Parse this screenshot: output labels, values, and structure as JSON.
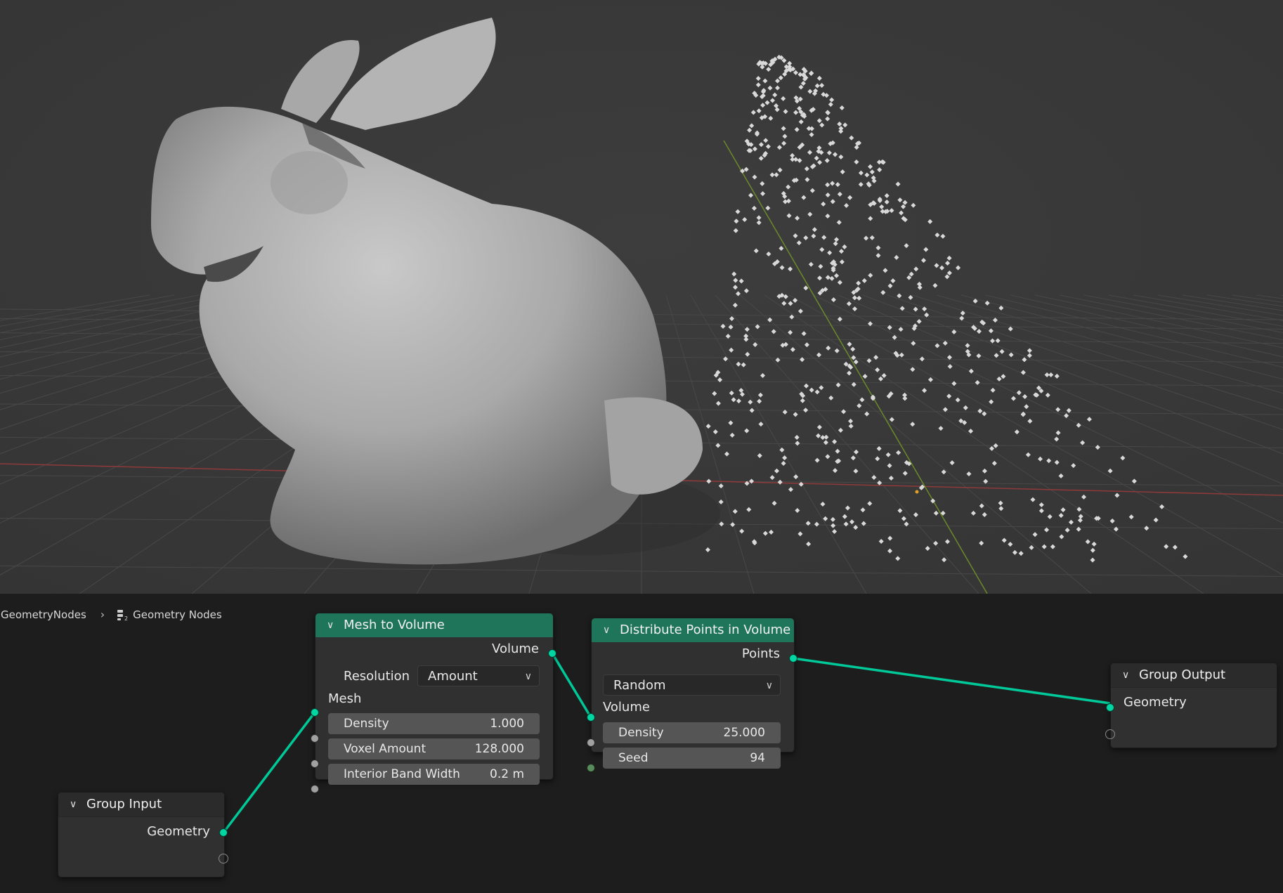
{
  "colors": {
    "viewport_bg": "#3a3a3a",
    "grid": "#4a4a4a",
    "x_axis": "#9b3a3a",
    "y_axis": "#6d8a2b",
    "node_editor_bg": "#1d1d1d",
    "geometry_socket": "#00d6a3",
    "float_socket": "#a1a1a1",
    "int_socket": "#598c5c",
    "node_header_green": "#1f7559",
    "link": "#00d6a3"
  },
  "breadcrumb": {
    "items": [
      "GeometryNodes",
      "Geometry Nodes"
    ],
    "icon": "node-tree-icon",
    "icon_subscript": "2"
  },
  "nodes": {
    "group_input": {
      "title": "Group Input",
      "outputs": [
        "Geometry"
      ]
    },
    "mesh_to_volume": {
      "title": "Mesh to Volume",
      "output": "Volume",
      "resolution_label": "Resolution",
      "resolution_value": "Amount",
      "input_mesh": "Mesh",
      "fields": [
        {
          "label": "Density",
          "value": "1.000"
        },
        {
          "label": "Voxel Amount",
          "value": "128.000"
        },
        {
          "label": "Interior Band Width",
          "value": "0.2 m"
        }
      ]
    },
    "distribute_points": {
      "title": "Distribute Points in Volume",
      "output": "Points",
      "mode_value": "Random",
      "input_volume": "Volume",
      "fields": [
        {
          "label": "Density",
          "value": "25.000"
        },
        {
          "label": "Seed",
          "value": "94"
        }
      ]
    },
    "group_output": {
      "title": "Group Output",
      "inputs": [
        "Geometry"
      ]
    }
  }
}
